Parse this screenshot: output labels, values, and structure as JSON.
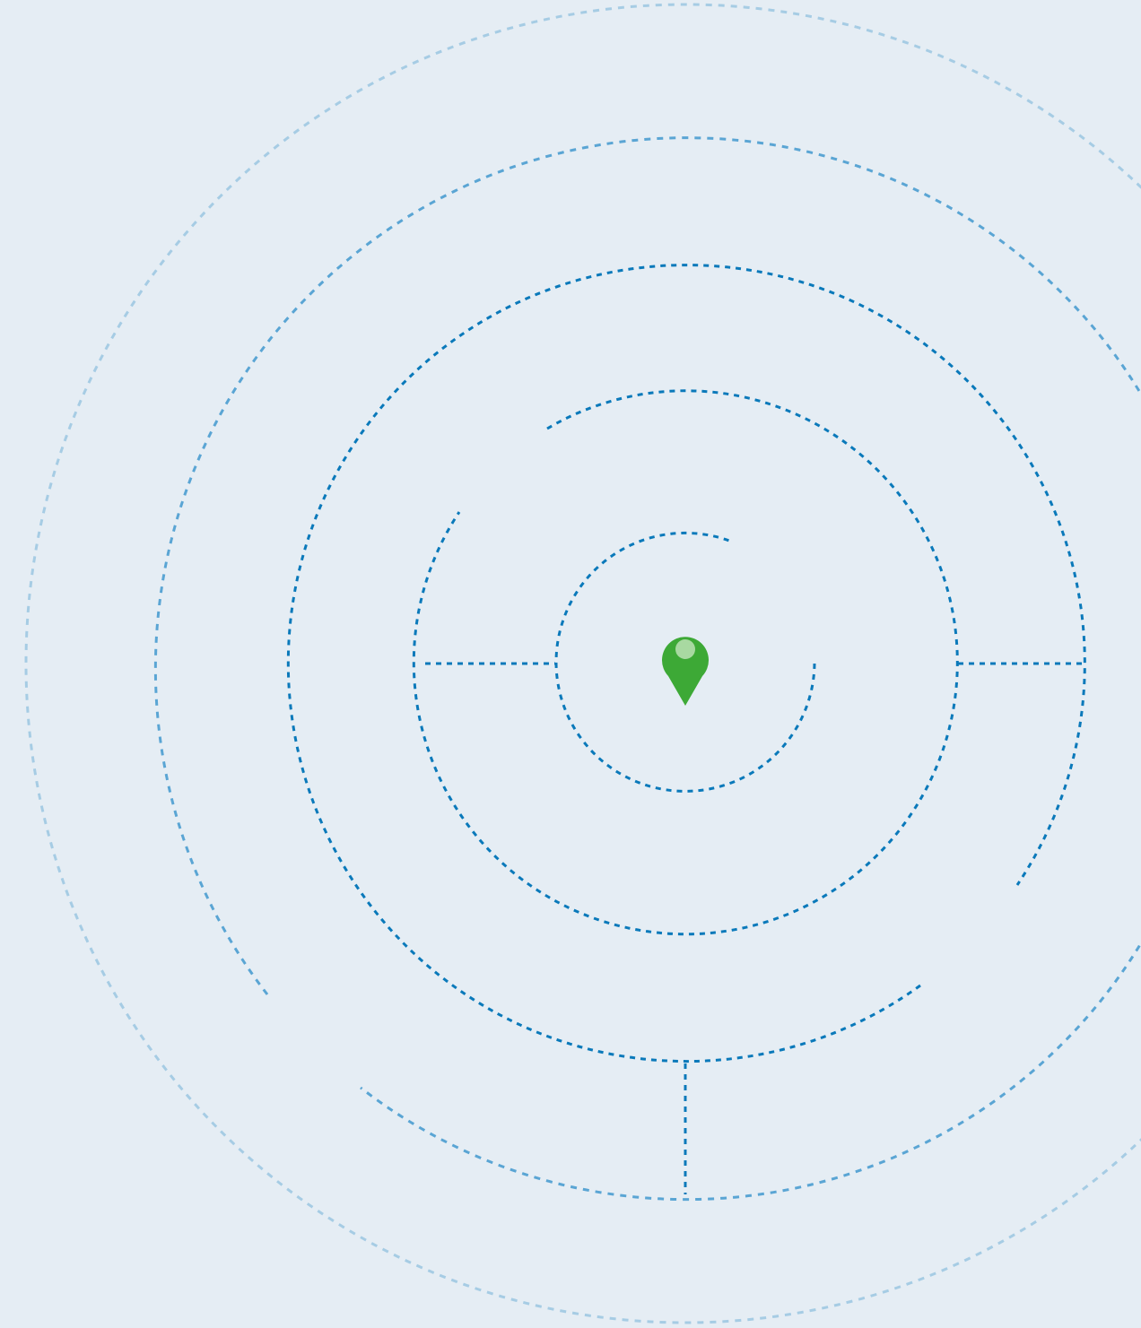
{
  "colors": {
    "background": "#E5EDF4",
    "ring_outer": "#A6CCE4",
    "ring_second": "#5AA5D4",
    "ring_inner": "#0A79BA",
    "pin": "#3DA936",
    "pin_dot": "#A8D9A1"
  },
  "icons": {
    "center_marker": "map-pin-icon"
  }
}
